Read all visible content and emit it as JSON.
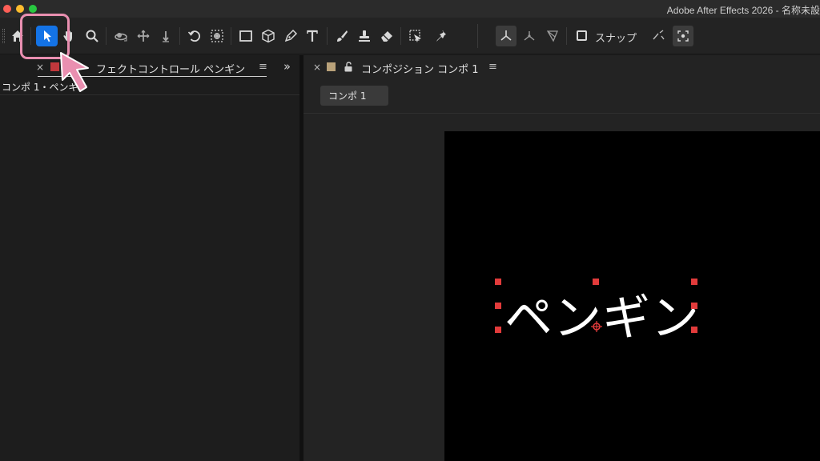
{
  "app": {
    "title": "Adobe After Effects 2026 - 名称未設"
  },
  "colors": {
    "accent_selected": "#1473e6",
    "highlight_pink": "#e98fb0",
    "handle_red": "#e23b3b",
    "layer_label_red": "#c0383c",
    "comp_label_tan": "#b9a27a"
  },
  "toolbar": {
    "tools": [
      "home-icon",
      "selection-arrow-icon",
      "hand-icon",
      "zoom-icon",
      "orbit-camera-icon",
      "pan-camera-icon",
      "dolly-camera-icon",
      "rotate-icon",
      "pan-behind-icon",
      "rectangle-icon",
      "3d-cube-icon",
      "pen-icon",
      "text-icon",
      "brush-icon",
      "clone-stamp-icon",
      "eraser-icon",
      "roto-brush-icon",
      "puppet-pin-icon",
      "axis-local-icon",
      "axis-world-icon",
      "axis-view-icon",
      "snap-icon",
      "snap-extra-icon"
    ],
    "selected_tool": "selection-arrow-icon",
    "snap_label": "スナップ",
    "snap_checked": false
  },
  "left_panel": {
    "tab_label": "エフェクトコントロール ペンギン",
    "visible_tab_label": "フェクトコントロール ペンギン",
    "layer_path": "コンポ 1・ペンギン"
  },
  "right_panel": {
    "tab_label": "コンポジション コンポ 1",
    "comp_button_label": "コンポ 1"
  },
  "canvas": {
    "text_layer": "ペンギン"
  }
}
